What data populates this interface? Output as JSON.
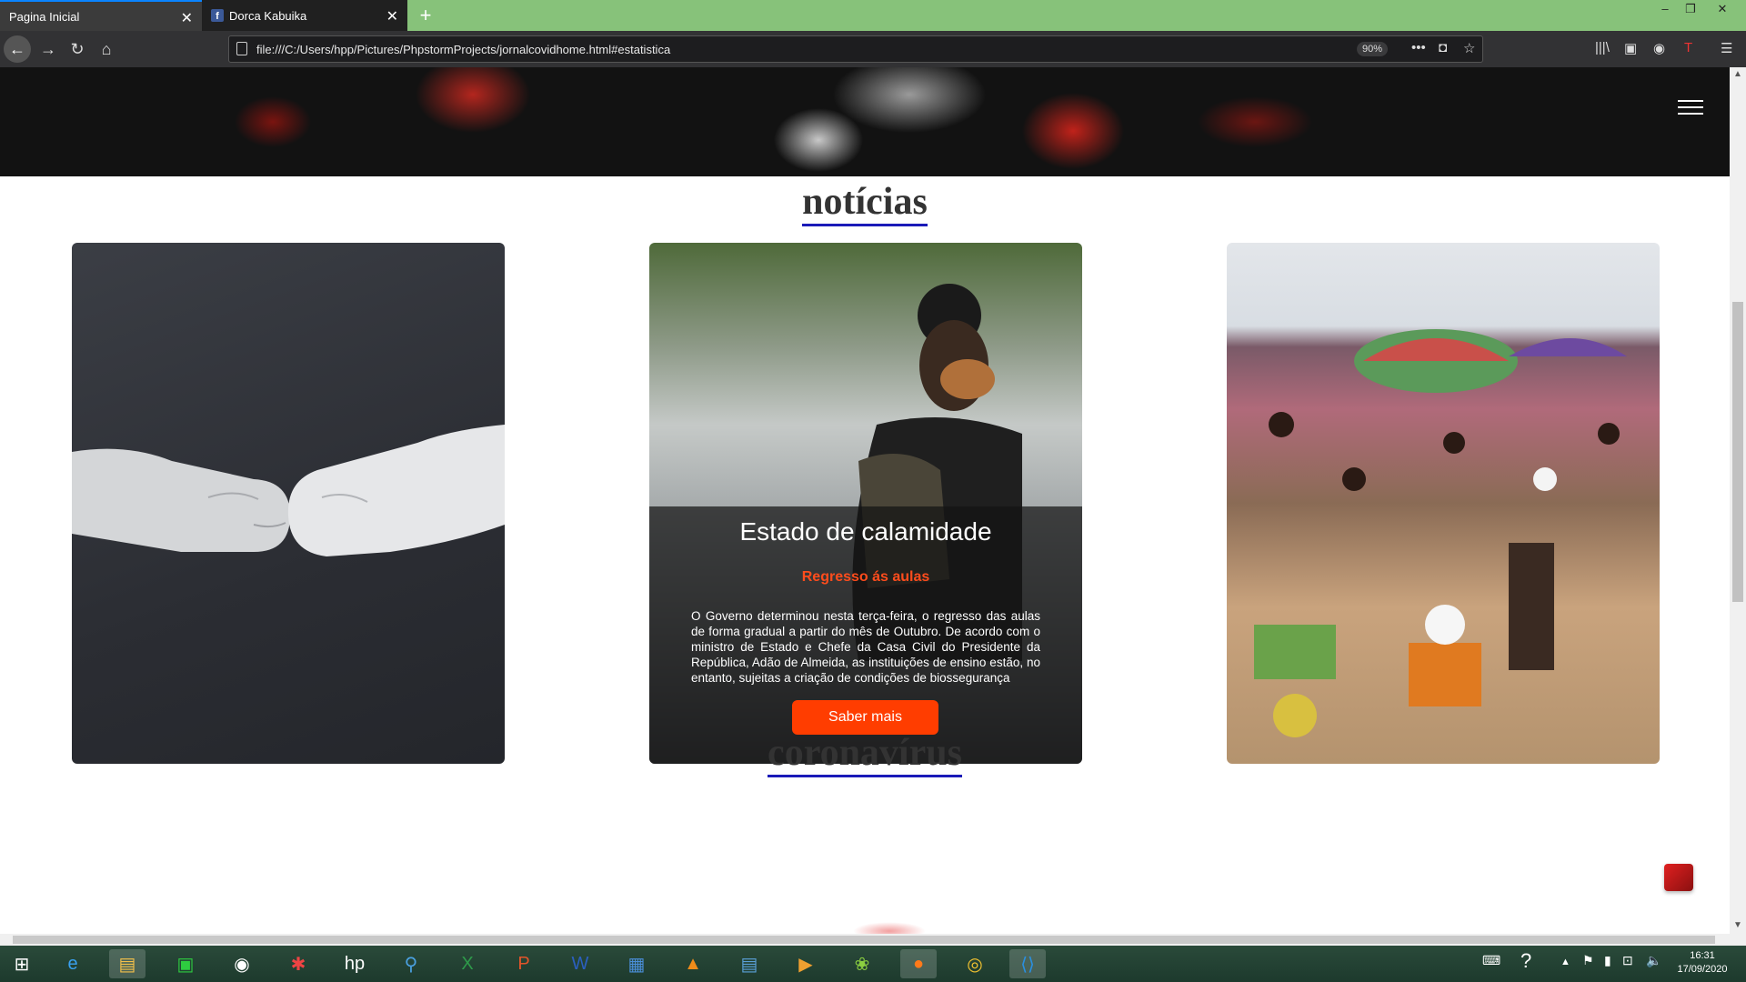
{
  "browser": {
    "tabs": [
      {
        "label": "Pagina Inicial",
        "active": true
      },
      {
        "label": "Dorca Kabuika",
        "active": false
      }
    ],
    "url": "file:///C:/Users/hpp/Pictures/PhpstormProjects/jornalcovidhome.html#estatistica",
    "zoom": "90%"
  },
  "page": {
    "news_title": "notícias",
    "corona_title": "coronavírus",
    "featured_card": {
      "title": "Estado de calamidade",
      "subtitle": "Regresso ás aulas",
      "text": "O Governo determinou nesta terça-feira, o regresso das aulas de forma gradual a partir do mês de Outubro. De acordo com o ministro de Estado e Chefe da Casa Civil do Presidente da República, Adão de Almeida, as instituições de ensino estão, no entanto, sujeitas a criação de condições de biossegurança",
      "button": "Saber mais"
    }
  },
  "taskbar": {
    "time": "16:31",
    "date": "17/09/2020"
  },
  "colors": {
    "accent": "#ff3d00",
    "title_underline": "#1a1ab8",
    "tabbar": "#87c27a"
  }
}
